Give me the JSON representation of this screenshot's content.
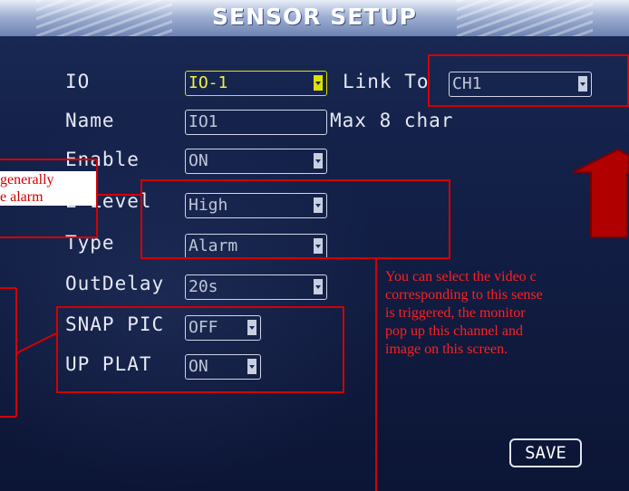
{
  "screen": {
    "title": "SENSOR SETUP",
    "fields": {
      "io": {
        "label": "IO",
        "value": "IO-1"
      },
      "link_to": {
        "label": "Link To",
        "value": "CH1"
      },
      "name": {
        "label": "Name",
        "value": "IO1",
        "hint": "Max 8 char"
      },
      "enable": {
        "label": "Enable",
        "value": "ON"
      },
      "e_level": {
        "label": "E-Level",
        "value": "High"
      },
      "type": {
        "label": "Type",
        "value": "Alarm"
      },
      "outdelay": {
        "label": "OutDelay",
        "value": "20s"
      },
      "snap_pic": {
        "label": "SNAP PIC",
        "value": "OFF"
      },
      "up_plat": {
        "label": "UP PLAT",
        "value": "ON"
      }
    },
    "save_label": "SAVE"
  },
  "annotations": {
    "left_callout_lines": [
      "generally",
      "e alarm"
    ],
    "video_note_lines": [
      "You can select the video c",
      "corresponding to this sense",
      "is triggered, the monitor",
      "pop up this channel and",
      "image on this screen."
    ],
    "colors": {
      "annotation_red": "#d40000",
      "field_active": "#e0e000"
    }
  }
}
